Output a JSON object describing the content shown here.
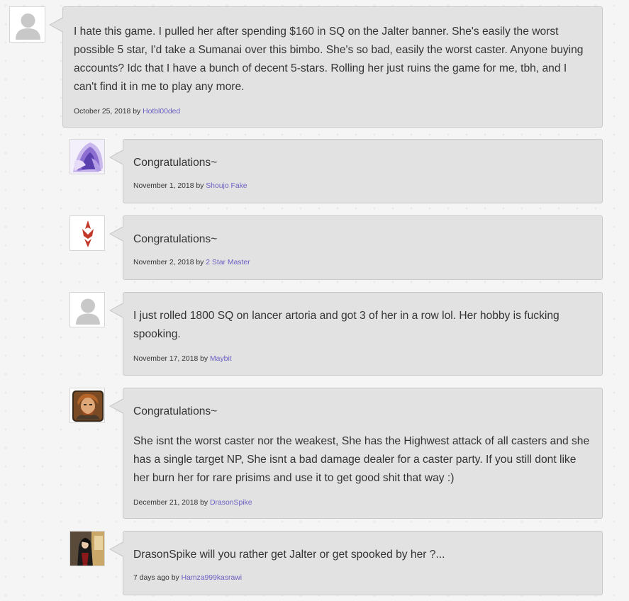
{
  "comments": [
    {
      "paragraphs": [
        "I hate this game. I pulled her after spending $160 in SQ on the Jalter banner. She's easily the worst possible 5 star, I'd take a  Sumanai over this  bimbo. She's so bad, easily the worst caster. Anyone buying accounts? Idc that I have a bunch of decent 5-stars. Rolling her just ruins the game for me, tbh, and I can't find it in me to play any more."
      ],
      "date": "October 25, 2018",
      "by": "by",
      "author": "Hotbl00ded",
      "avatar_icon": "default-user-icon"
    },
    {
      "paragraphs": [
        "Congratulations~"
      ],
      "date": "November 1, 2018",
      "by": "by",
      "author": "Shoujo Fake",
      "avatar_icon": "anime-girl-avatar"
    },
    {
      "paragraphs": [
        "Congratulations~"
      ],
      "date": "November 2, 2018",
      "by": "by",
      "author": "2 Star Master",
      "avatar_icon": "red-crest-avatar"
    },
    {
      "paragraphs": [
        "I just rolled 1800 SQ on lancer artoria and got 3 of her in a row lol. Her hobby is fucking spooking."
      ],
      "date": "November 17, 2018",
      "by": "by",
      "author": "Maybit",
      "avatar_icon": "default-user-icon"
    },
    {
      "paragraphs": [
        "Congratulations~",
        "She isnt the worst caster nor the weakest, She has the Highwest attack of all casters and she has a single target NP, She isnt a bad damage dealer for a caster party.  If you still dont like her burn her for rare prisims and use it to get good shit that way :)"
      ],
      "date": "December 21, 2018",
      "by": "by",
      "author": "DrasonSpike",
      "avatar_icon": "bearded-man-avatar"
    },
    {
      "paragraphs": [
        "DrasonSpike will you rather get Jalter or get spooked by her ?..."
      ],
      "date": "7 days ago",
      "by": "by",
      "author": "Hamza999kasrawi",
      "avatar_icon": "dark-character-avatar"
    }
  ],
  "colors": {
    "bubble_bg": "#e2e2e2",
    "bubble_border": "#c9c9c9",
    "author_link": "#6a5fc2",
    "page_bg": "#f5f5f5"
  }
}
